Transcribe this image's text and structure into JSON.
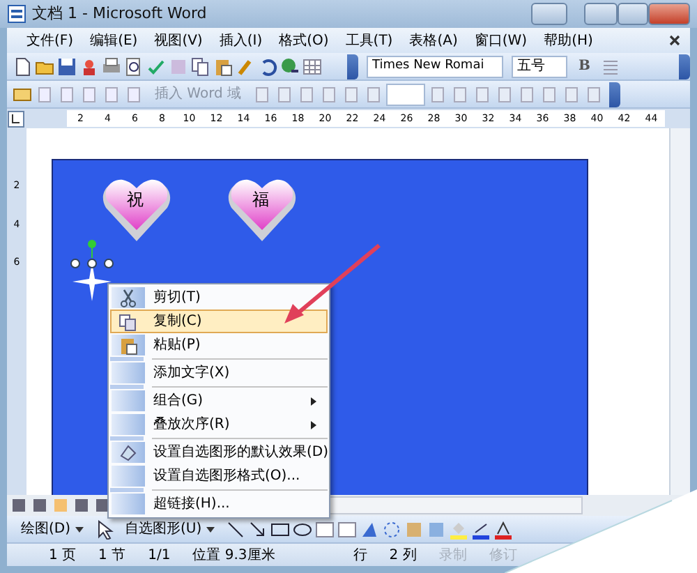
{
  "window": {
    "title": "文档 1 - Microsoft Word"
  },
  "menu_bar": [
    "文件(F)",
    "编辑(E)",
    "视图(V)",
    "插入(I)",
    "格式(O)",
    "工具(T)",
    "表格(A)",
    "窗口(W)",
    "帮助(H)"
  ],
  "formatting_toolbar": {
    "font": "Times New Romai",
    "size": "五号",
    "bold": "B"
  },
  "fields_toolbar": {
    "insert_field": "插入 Word 域"
  },
  "ruler": [
    "2",
    "4",
    "6",
    "8",
    "10",
    "12",
    "14",
    "16",
    "18",
    "20",
    "22",
    "24",
    "26",
    "28",
    "30",
    "32",
    "34",
    "36",
    "38",
    "40",
    "42",
    "44"
  ],
  "vertical_ruler": [
    "2",
    "4",
    "6"
  ],
  "canvas": {
    "shapes": [
      {
        "kind": "heart",
        "label": "祝"
      },
      {
        "kind": "heart",
        "label": "福"
      },
      {
        "kind": "star",
        "selected": true
      }
    ]
  },
  "context_menu": [
    {
      "kind": "item",
      "label": "剪切(T)",
      "selected": false,
      "submenu": false
    },
    {
      "kind": "item",
      "label": "复制(C)",
      "selected": true,
      "submenu": false
    },
    {
      "kind": "item",
      "label": "粘贴(P)",
      "selected": false,
      "submenu": false
    },
    {
      "kind": "separator"
    },
    {
      "kind": "item",
      "label": "添加文字(X)",
      "selected": false,
      "submenu": false
    },
    {
      "kind": "separator"
    },
    {
      "kind": "item",
      "label": "组合(G)",
      "selected": false,
      "submenu": true
    },
    {
      "kind": "item",
      "label": "叠放次序(R)",
      "selected": false,
      "submenu": true
    },
    {
      "kind": "separator"
    },
    {
      "kind": "item",
      "label": "设置自选图形的默认效果(D)",
      "selected": false,
      "submenu": false
    },
    {
      "kind": "item",
      "label": "设置自选图形格式(O)...",
      "selected": false,
      "submenu": false
    },
    {
      "kind": "separator"
    },
    {
      "kind": "item",
      "label": "超链接(H)...",
      "selected": false,
      "submenu": false
    }
  ],
  "drawing_toolbar": {
    "draw": "绘图(D)",
    "autoshapes": "自选图形(U)"
  },
  "status_bar": [
    {
      "text": "1 页",
      "disabled": false
    },
    {
      "text": "1 节",
      "disabled": false
    },
    {
      "text": "1/1",
      "disabled": false
    },
    {
      "text": "位置 9.3厘米",
      "disabled": false
    },
    {
      "text": "行",
      "disabled": false
    },
    {
      "text": "2 列",
      "disabled": false
    },
    {
      "text": "录制",
      "disabled": true
    },
    {
      "text": "修订",
      "disabled": true
    }
  ]
}
